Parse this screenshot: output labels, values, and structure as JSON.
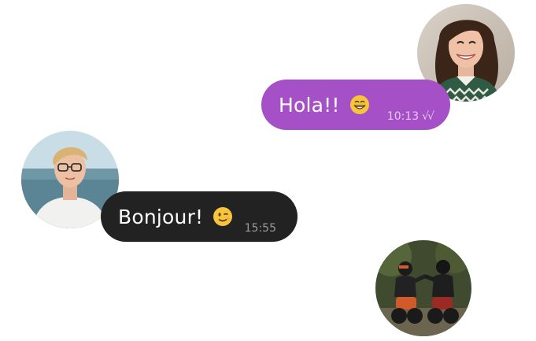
{
  "messages": [
    {
      "direction": "sent",
      "text": "Hola!!",
      "emoji": "grinning-face-with-smiling-eyes-emoji",
      "time": "10:13",
      "status": "√√"
    },
    {
      "direction": "received",
      "text": "Bonjour!",
      "emoji": "winking-face-emoji",
      "time": "15:55"
    }
  ],
  "colors": {
    "sent_bubble": "#a550c6",
    "received_bubble": "#222222",
    "message_text": "#ffffff",
    "sent_meta": "#e6c8f0",
    "received_meta": "#9a9a9a",
    "background": "#ffffff"
  },
  "avatars": [
    {
      "name": "woman-avatar",
      "description_icon": "smiling-woman-photo"
    },
    {
      "name": "boy-avatar",
      "description_icon": "boy-with-glasses-photo"
    },
    {
      "name": "motorcycle-riders-avatar",
      "description_icon": "motorcycle-riders-photo"
    }
  ]
}
